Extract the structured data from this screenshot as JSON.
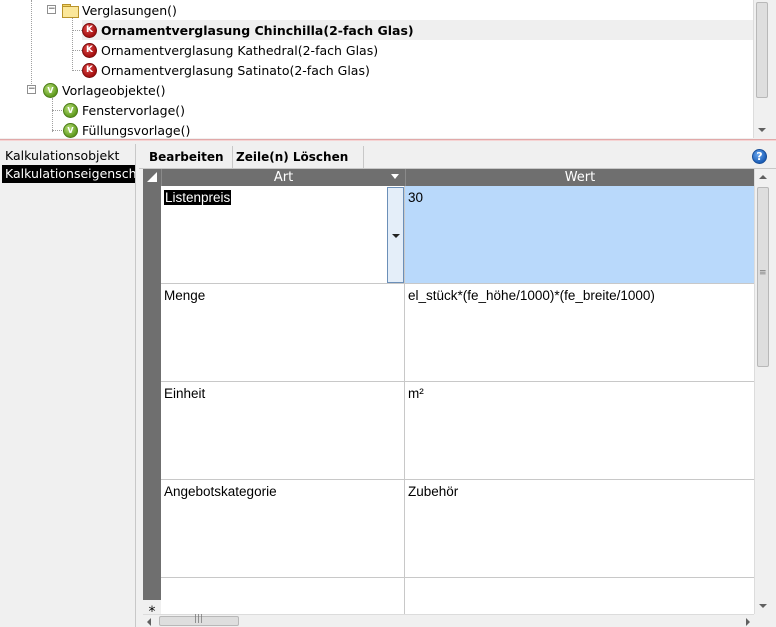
{
  "tree": {
    "nodes": [
      {
        "label": "Verglasungen()",
        "icon": "folder-icon"
      },
      {
        "label": "Ornamentverglasung Chinchilla(2-fach Glas)",
        "icon": "k-icon",
        "icon_glyph": "K",
        "selected": true
      },
      {
        "label": "Ornamentverglasung Kathedral(2-fach Glas)",
        "icon": "k-icon",
        "icon_glyph": "K"
      },
      {
        "label": "Ornamentverglasung Satinato(2-fach Glas)",
        "icon": "k-icon",
        "icon_glyph": "K"
      },
      {
        "label": "Vorlageobjekte()",
        "icon": "v-icon",
        "icon_glyph": "V"
      },
      {
        "label": "Fenstervorlage()",
        "icon": "v-icon",
        "icon_glyph": "V"
      },
      {
        "label": "Füllungsvorlage()",
        "icon": "v-icon",
        "icon_glyph": "V"
      }
    ],
    "expander_glyph": "−"
  },
  "leftnav": {
    "items": [
      {
        "label": "Kalkulationsobjekt"
      },
      {
        "label": "Kalkulationseigenschaften",
        "active": true
      }
    ]
  },
  "toolbar": {
    "edit_label": "Bearbeiten",
    "delete_rows_label": "Zeile(n) Löschen",
    "help_glyph": "?"
  },
  "grid": {
    "columns": [
      "Art",
      "Wert"
    ],
    "rows": [
      {
        "art": "Listenpreis",
        "wert": "30"
      },
      {
        "art": "Menge",
        "wert": "el_stück*(fe_höhe/1000)*(fe_breite/1000)"
      },
      {
        "art": "Einheit",
        "wert": "m²"
      },
      {
        "art": "Angebotskategorie",
        "wert": "Zubehör"
      }
    ],
    "new_row_marker": "*",
    "hscroll_grip": "|||",
    "vscroll_grip": "≡"
  },
  "colors": {
    "selection": "#b9d9fb",
    "grid_header": "#6f6f6f",
    "k_icon": "#c0392b",
    "v_icon": "#7cb342"
  }
}
